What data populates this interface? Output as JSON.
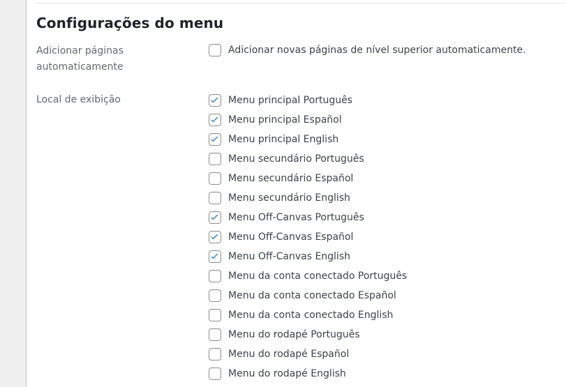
{
  "page": {
    "title": "Configurações do menu"
  },
  "rows": [
    {
      "label": "Adicionar páginas automaticamente",
      "options": [
        {
          "label": "Adicionar novas páginas de nível superior automaticamente.",
          "checked": false
        }
      ]
    },
    {
      "label": "Local de exibição",
      "options": [
        {
          "label": "Menu principal Português",
          "checked": true
        },
        {
          "label": "Menu principal Español",
          "checked": true
        },
        {
          "label": "Menu principal English",
          "checked": true
        },
        {
          "label": "Menu secundário Português",
          "checked": false
        },
        {
          "label": "Menu secundário Español",
          "checked": false
        },
        {
          "label": "Menu secundário English",
          "checked": false
        },
        {
          "label": "Menu Off-Canvas Português",
          "checked": true
        },
        {
          "label": "Menu Off-Canvas Español",
          "checked": true
        },
        {
          "label": "Menu Off-Canvas English",
          "checked": true
        },
        {
          "label": "Menu da conta conectado Português",
          "checked": false
        },
        {
          "label": "Menu da conta conectado Español",
          "checked": false
        },
        {
          "label": "Menu da conta conectado English",
          "checked": false
        },
        {
          "label": "Menu do rodapé Português",
          "checked": false
        },
        {
          "label": "Menu do rodapé Español",
          "checked": false
        },
        {
          "label": "Menu do rodapé English",
          "checked": false
        }
      ]
    }
  ],
  "colors": {
    "checkmark": "#3582c4",
    "checkbox_border": "#8c8f94",
    "label_text": "#646970",
    "option_text": "#3c434a",
    "title_text": "#1d2327",
    "rail_bg": "#f0f0f1",
    "divider": "#e6e6e7"
  }
}
